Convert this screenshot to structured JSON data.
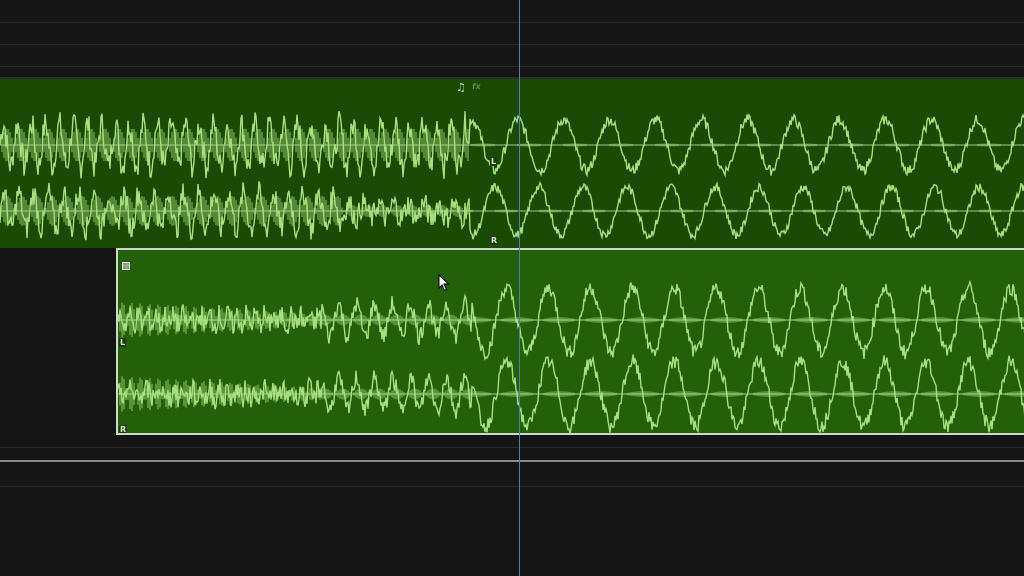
{
  "timeline": {
    "channel_left": "L",
    "channel_right": "R",
    "clip_a": {
      "icon": "music-note-icon",
      "fx_icon": "fx-icon",
      "fx_label": "fx"
    },
    "clip_b": {
      "icon": "keyframe-box-icon"
    },
    "colors": {
      "clip_bg": "#1a4a03",
      "clip_selected_bg": "#245f0a",
      "waveform": "#a8df7f",
      "playhead": "#4f7fb4",
      "selection_border": "#cfd6cf"
    }
  }
}
